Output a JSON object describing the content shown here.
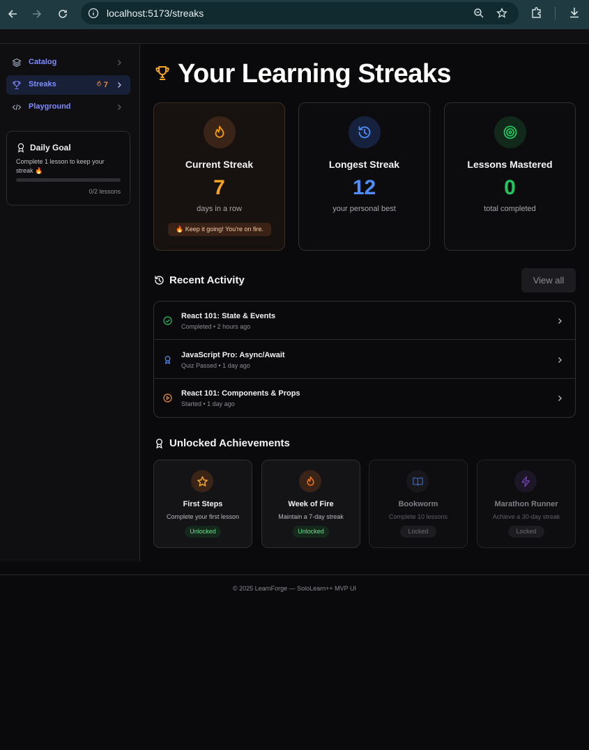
{
  "browser": {
    "url": "localhost:5173/streaks"
  },
  "sidebar": {
    "items": [
      {
        "label": "Catalog",
        "icon": "layers-icon"
      },
      {
        "label": "Streaks",
        "icon": "trophy-icon",
        "badge": "7",
        "active": true
      },
      {
        "label": "Playground",
        "icon": "code-icon"
      }
    ],
    "goal": {
      "title": "Daily Goal",
      "description": "Complete 1 lesson to keep your streak 🔥",
      "progress": 0,
      "count": "0/2 lessons"
    }
  },
  "main": {
    "title": "Your Learning Streaks",
    "stats": [
      {
        "label": "Current Streak",
        "value": "7",
        "sub": "days in a row",
        "note": "🔥 Keep it going! You're on fire.",
        "color": "#f5a524"
      },
      {
        "label": "Longest Streak",
        "value": "12",
        "sub": "your personal best",
        "color": "#4f8ef7"
      },
      {
        "label": "Lessons Mastered",
        "value": "0",
        "sub": "total completed",
        "color": "#22c55e"
      }
    ],
    "activity": {
      "heading": "Recent Activity",
      "view_all": "View all",
      "rows": [
        {
          "title": "React 101: State & Events",
          "meta": "Completed • 2 hours ago",
          "icon": "check-circle-icon"
        },
        {
          "title": "JavaScript Pro: Async/Await",
          "meta": "Quiz Passed • 1 day ago",
          "icon": "award-icon"
        },
        {
          "title": "React 101: Components & Props",
          "meta": "Started • 1 day ago",
          "icon": "play-circle-icon"
        }
      ]
    },
    "achievements": {
      "heading": "Unlocked Achievements",
      "items": [
        {
          "name": "First Steps",
          "desc": "Complete your first lesson",
          "status": "Unlocked",
          "icon": "star-icon"
        },
        {
          "name": "Week of Fire",
          "desc": "Maintain a 7-day streak",
          "status": "Unlocked",
          "icon": "flame-icon"
        },
        {
          "name": "Bookworm",
          "desc": "Complete 10 lessons",
          "status": "Locked",
          "icon": "book-icon"
        },
        {
          "name": "Marathon Runner",
          "desc": "Achieve a 30-day streak",
          "status": "Locked",
          "icon": "zap-icon"
        }
      ]
    }
  },
  "footer": {
    "text": "© 2025 LearnForge — SoloLearn++ MVP UI"
  }
}
